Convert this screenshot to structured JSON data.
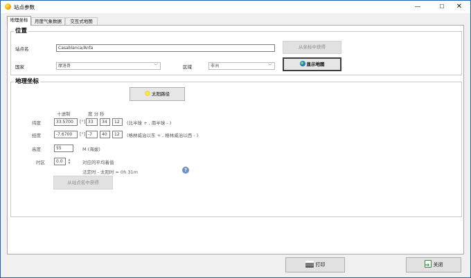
{
  "window": {
    "title": "站点参数",
    "minimize": "—",
    "maximize": "☐",
    "close": "✕"
  },
  "tabs": [
    "地理坐标",
    "月度气象数据",
    "交互式地图"
  ],
  "location": {
    "legend": "位置",
    "site_label": "站点名",
    "site_value": "Casablanca/Anfa",
    "country_label": "国家",
    "country_value": "摩洛哥",
    "region_label": "区域",
    "region_value": "非洲",
    "from_coords_button": "从坐标中获得",
    "show_map_button": "显示地图"
  },
  "geo": {
    "legend": "地理坐标",
    "sun_path_button": "太阳路径",
    "decimal_header": "十进制",
    "dms_header": "度 分 秒",
    "latitude_label": "纬度",
    "latitude_decimal": "33.5700",
    "lat_deg": "33",
    "lat_min": "34",
    "lat_sec": "12",
    "lat_hint": "(北半球 + ,  南半球 - )",
    "longitude_label": "经度",
    "longitude_decimal": "-7.6700",
    "lon_deg": "-7",
    "lon_min": "40",
    "lon_sec": "12",
    "lon_hint": "(格林威治以东 + ,  格林威治以西 - )",
    "degree_symbol": "[°]",
    "altitude_label": "高度",
    "altitude_value": "55",
    "altitude_unit": "M (海拔)",
    "timezone_label": "时区",
    "timezone_value": "0.0",
    "timezone_hint": "对应的平均着值",
    "legal_time": "法定时 - 太阳时 =   0h 31m",
    "help": "?",
    "from_site_button": "从站点名中获得"
  },
  "footer": {
    "print_button": "打印",
    "close_button": "关闭"
  }
}
